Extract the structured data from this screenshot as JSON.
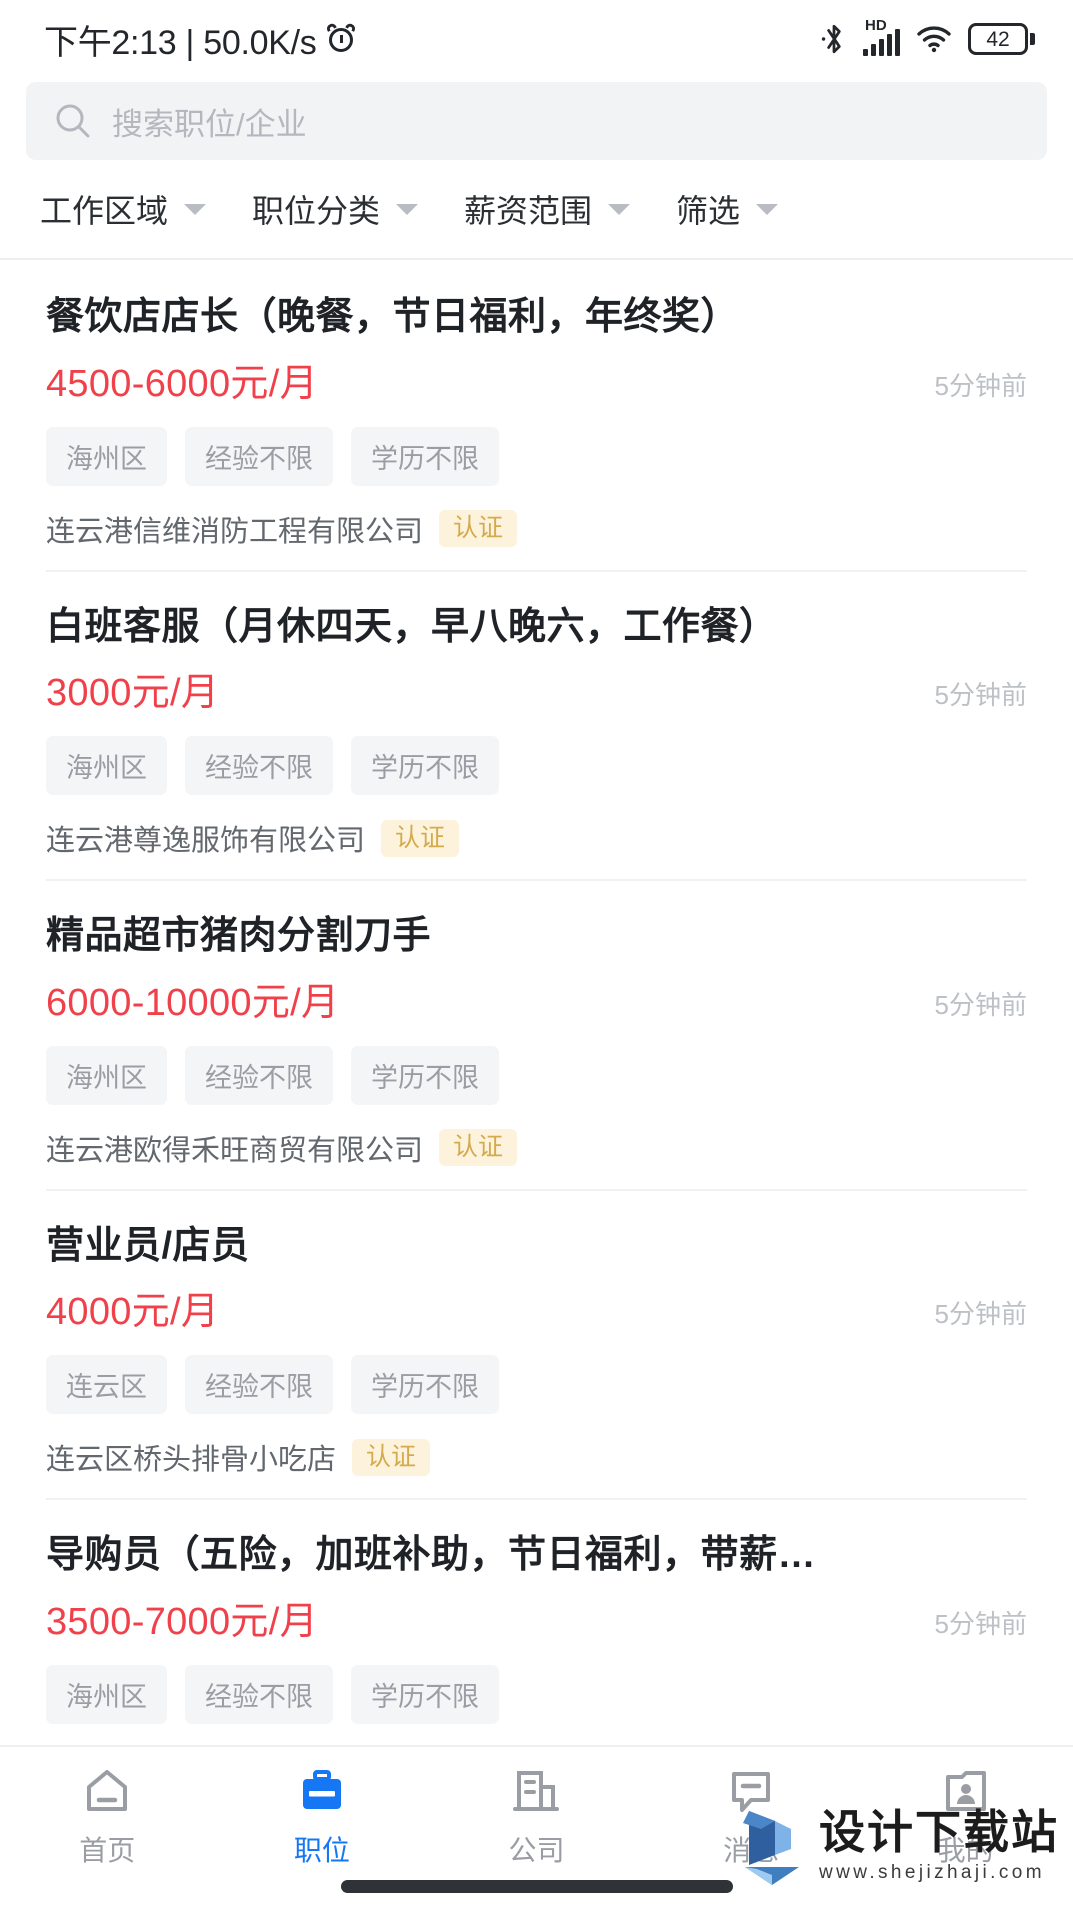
{
  "status_bar": {
    "time": "下午2:13",
    "separator": "|",
    "network_speed": "50.0K/s",
    "alarm_icon": "alarm-clock-icon",
    "bluetooth_icon": "bluetooth-icon",
    "hd_label": "HD",
    "signal_icon": "cellular-signal-icon",
    "wifi_icon": "wifi-icon",
    "battery_level": "42"
  },
  "search": {
    "placeholder": "搜索职位/企业",
    "icon": "search-icon"
  },
  "filters": [
    {
      "label": "工作区域",
      "icon": "chevron-down-icon"
    },
    {
      "label": "职位分类",
      "icon": "chevron-down-icon"
    },
    {
      "label": "薪资范围",
      "icon": "chevron-down-icon"
    },
    {
      "label": "筛选",
      "icon": "chevron-down-icon"
    }
  ],
  "jobs": [
    {
      "title": "餐饮店店长（晚餐，节日福利，年终奖）",
      "salary": "4500-6000元/月",
      "posted": "5分钟前",
      "tags": [
        "海州区",
        "经验不限",
        "学历不限"
      ],
      "company": "连云港信维消防工程有限公司",
      "cert": "认证"
    },
    {
      "title": "白班客服（月休四天，早八晚六，工作餐）",
      "salary": "3000元/月",
      "posted": "5分钟前",
      "tags": [
        "海州区",
        "经验不限",
        "学历不限"
      ],
      "company": "连云港尊逸服饰有限公司",
      "cert": "认证"
    },
    {
      "title": "精品超市猪肉分割刀手",
      "salary": "6000-10000元/月",
      "posted": "5分钟前",
      "tags": [
        "海州区",
        "经验不限",
        "学历不限"
      ],
      "company": "连云港欧得禾旺商贸有限公司",
      "cert": "认证"
    },
    {
      "title": "营业员/店员",
      "salary": "4000元/月",
      "posted": "5分钟前",
      "tags": [
        "连云区",
        "经验不限",
        "学历不限"
      ],
      "company": "连云区桥头排骨小吃店",
      "cert": "认证"
    },
    {
      "title": "导购员（五险，加班补助，节日福利，带薪…",
      "salary": "3500-7000元/月",
      "posted": "5分钟前",
      "tags": [
        "海州区",
        "经验不限",
        "学历不限"
      ],
      "company": "",
      "cert": ""
    }
  ],
  "tabbar": {
    "items": [
      {
        "label": "首页",
        "icon": "home-icon",
        "active": false
      },
      {
        "label": "职位",
        "icon": "briefcase-icon",
        "active": true
      },
      {
        "label": "公司",
        "icon": "building-icon",
        "active": false
      },
      {
        "label": "消息",
        "icon": "message-bubble-icon",
        "active": false
      },
      {
        "label": "我的",
        "icon": "profile-card-icon",
        "active": false
      }
    ],
    "active_color": "#1677f5",
    "inactive_color": "#9a9ea4"
  },
  "watermark": {
    "title": "设计下载站",
    "url": "www.shejizhaji.com",
    "logo": "download-arrow-logo"
  },
  "colors": {
    "salary_red": "#f0414b",
    "accent_blue": "#1677f5",
    "tag_bg": "#f4f5f7",
    "cert_bg": "#fdf3dc",
    "cert_text": "#d3ab4e"
  }
}
